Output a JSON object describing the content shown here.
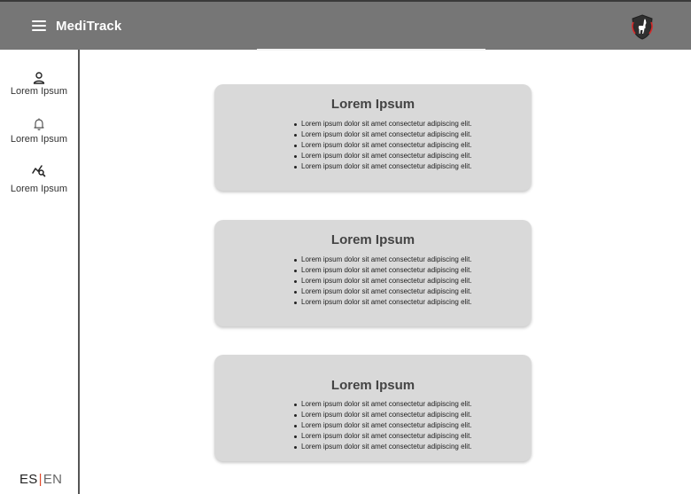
{
  "header": {
    "app_title": "MediTrack",
    "menu_icon": "hamburger-menu-icon",
    "logo_icon": "llama-shield-logo"
  },
  "sidebar": {
    "items": [
      {
        "icon": "user-icon",
        "label": "Lorem Ipsum"
      },
      {
        "icon": "bell-icon",
        "label": "Lorem Ipsum"
      },
      {
        "icon": "chart-search-icon",
        "label": "Lorem Ipsum"
      }
    ],
    "language": {
      "es": "ES",
      "separator": "|",
      "en": "EN"
    }
  },
  "cards": [
    {
      "title": "Lorem Ipsum",
      "items": [
        "Lorem ipsum dolor sit amet consectetur adipiscing elit.",
        "Lorem ipsum dolor sit amet consectetur adipiscing elit.",
        "Lorem ipsum dolor sit amet consectetur adipiscing elit.",
        "Lorem ipsum dolor sit amet consectetur adipiscing elit.",
        "Lorem ipsum dolor sit amet consectetur adipiscing elit."
      ]
    },
    {
      "title": "Lorem Ipsum",
      "items": [
        "Lorem ipsum dolor sit amet consectetur adipiscing elit.",
        "Lorem ipsum dolor sit amet consectetur adipiscing elit.",
        "Lorem ipsum dolor sit amet consectetur adipiscing elit.",
        "Lorem ipsum dolor sit amet consectetur adipiscing elit.",
        "Lorem ipsum dolor sit amet consectetur adipiscing elit."
      ]
    },
    {
      "title": "Lorem Ipsum",
      "items": [
        "Lorem ipsum dolor sit amet consectetur adipiscing elit.",
        "Lorem ipsum dolor sit amet consectetur adipiscing elit.",
        "Lorem ipsum dolor sit amet consectetur adipiscing elit.",
        "Lorem ipsum dolor sit amet consectetur adipiscing elit.",
        "Lorem ipsum dolor sit amet consectetur adipiscing elit."
      ]
    }
  ],
  "colors": {
    "header_bg": "#767676",
    "card_bg": "#d9d9d9",
    "accent_red": "#e0492a"
  }
}
